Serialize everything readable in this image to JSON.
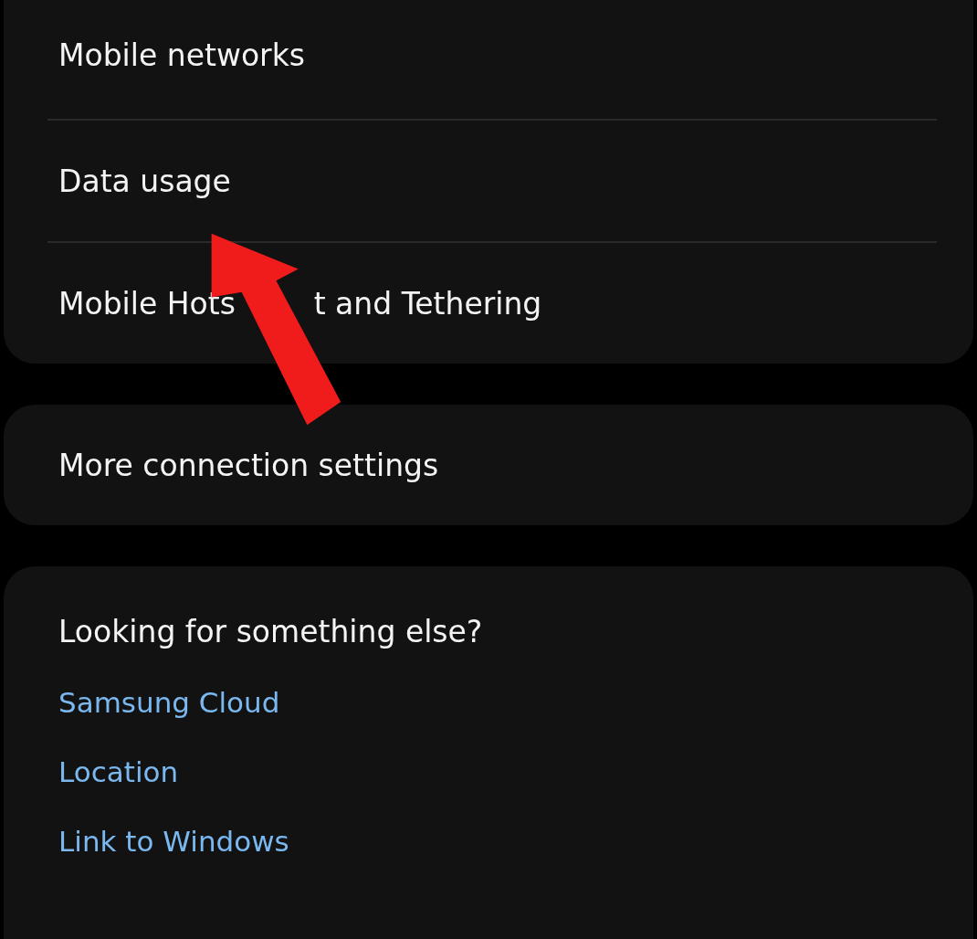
{
  "connection_settings": [
    {
      "items": [
        {
          "label": "Mobile networks"
        },
        {
          "label": "Data usage"
        },
        {
          "label": "Mobile Hots",
          "label_continued": "t and Tethering"
        }
      ]
    },
    {
      "items": [
        {
          "label": "More connection settings"
        }
      ]
    }
  ],
  "suggestions": {
    "title": "Looking for something else?",
    "links": [
      "Samsung Cloud",
      "Location",
      "Link to Windows"
    ]
  }
}
